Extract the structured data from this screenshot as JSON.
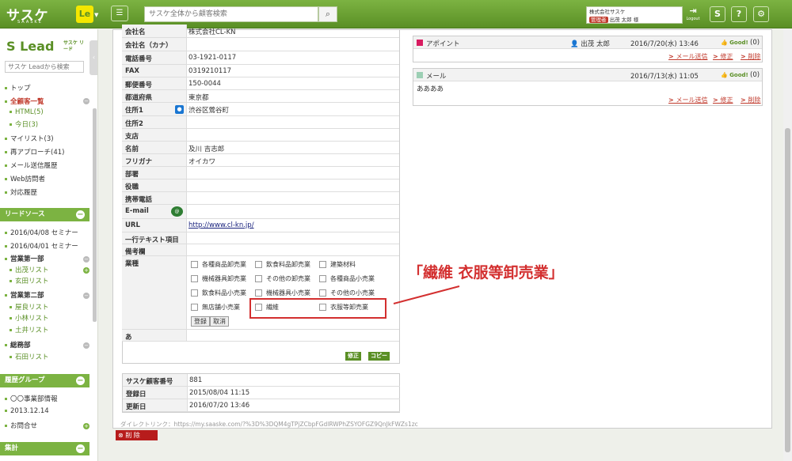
{
  "header": {
    "logo": "サスケ",
    "logo_sub": "SAASKE",
    "le_badge": "Le",
    "search_placeholder": "サスケ全体から顧客検索",
    "company": "株式会社サスケ",
    "role": "管理者",
    "user_name": "出茂 太郎 様",
    "logout_label": "Logout"
  },
  "sidebar": {
    "title": "Lead",
    "title_sub": "サスケ リード",
    "search_placeholder": "サスケ Leadから検索",
    "nav": [
      "トップ",
      "全顧客一覧",
      "HTML(5)",
      "今日(3)",
      "マイリスト(3)",
      "再アプローチ(41)",
      "メール送信履歴",
      "Web訪問者",
      "対応履歴"
    ],
    "lead_source_title": "リードソース",
    "lead_sources": [
      "2016/04/08 セミナー",
      "2016/04/01 セミナー",
      "営業第一部",
      "出茂リスト",
      "玄田リスト",
      "営業第二部",
      "屋良リスト",
      "小林リスト",
      "土井リスト",
      "総務部",
      "石田リスト"
    ],
    "history_title": "履歴グループ",
    "history": [
      "〇〇事業部情報",
      "2013.12.14",
      "お問合せ"
    ],
    "agg_title": "集計"
  },
  "form": {
    "rows": [
      {
        "k": "会社名",
        "v": "株式会社CL-KN"
      },
      {
        "k": "会社名（カナ）",
        "v": ""
      },
      {
        "k": "電話番号",
        "v": "03-1921-0117"
      },
      {
        "k": "FAX",
        "v": "0319210117"
      },
      {
        "k": "郵便番号",
        "v": "150-0044"
      },
      {
        "k": "都道府県",
        "v": "東京都"
      },
      {
        "k": "住所1",
        "v": "渋谷区鶯谷町"
      },
      {
        "k": "住所2",
        "v": ""
      },
      {
        "k": "支店",
        "v": ""
      },
      {
        "k": "名前",
        "v": "及川 吉志郎"
      },
      {
        "k": "フリガナ",
        "v": "オイカワ"
      },
      {
        "k": "部署",
        "v": ""
      },
      {
        "k": "役職",
        "v": ""
      },
      {
        "k": "携帯電話",
        "v": ""
      },
      {
        "k": "E-mail",
        "v": ""
      },
      {
        "k": "URL",
        "v": "http://www.cl-kn.jp/"
      },
      {
        "k": "一行テキスト項目",
        "v": ""
      },
      {
        "k": "備考欄",
        "v": ""
      },
      {
        "k": "業種",
        "v": ""
      },
      {
        "k": "あ",
        "v": ""
      }
    ],
    "industries": [
      "各種商品卸売業",
      "飲食料品卸売業",
      "建築材料",
      "機械器具卸売業",
      "その他の卸売業",
      "各種商品小売業",
      "飲食料品小売業",
      "機械器具小売業",
      "その他の小売業",
      "無店舗小売業",
      "繊維",
      "衣服等卸売業"
    ],
    "register_label": "登録",
    "cancel_label": "取消",
    "edit_label": "修正",
    "copy_label": "コピー"
  },
  "meta": [
    {
      "k": "サスケ顧客番号",
      "v": "881"
    },
    {
      "k": "登録日",
      "v": "2015/08/04 11:15"
    },
    {
      "k": "更新日",
      "v": "2016/07/20 13:46"
    }
  ],
  "direct_link": "ダイレクトリンク：https://my.saaske.com/?%3D%3DQM4gTPjZCbpFGdlRWPhZSYOFGZ9QnJkFWZs1zc",
  "delete_label": "削 除",
  "feed": [
    {
      "type": "アポイント",
      "color": "#d81b60",
      "who": "出茂 太郎",
      "date": "2016/7/20(水) 13:46",
      "good": "Good!",
      "count": "(0)",
      "body": ""
    },
    {
      "type": "メール",
      "color": "#9ccfb4",
      "who": "",
      "date": "2016/7/13(水) 11:05",
      "good": "Good!",
      "count": "(0)",
      "body": "ああああ"
    }
  ],
  "feed_actions": {
    "mail": "メール送信",
    "edit": "修正",
    "del": "削除"
  },
  "callout": "「繊維  衣服等卸売業」"
}
